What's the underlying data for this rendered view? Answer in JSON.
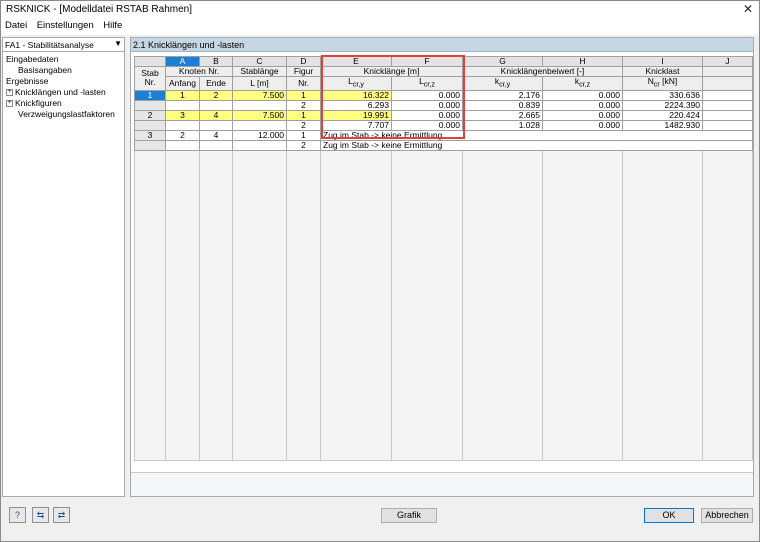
{
  "window": {
    "title": "RSKNICK - [Modelldatei RSTAB Rahmen]",
    "close": "✕"
  },
  "menu": [
    "Datei",
    "Einstellungen",
    "Hilfe"
  ],
  "left": {
    "combo": "FA1 - Stabilitätsanalyse",
    "tree": {
      "input_group": "Eingabedaten",
      "base": "Basisangaben",
      "results_group": "Ergebnisse",
      "item1": "Knicklängen und -lasten",
      "item2": "Knickfiguren",
      "item3": "Verzweigungslastfaktoren"
    }
  },
  "section_title": "2.1 Knicklängen und -lasten",
  "columns": [
    "A",
    "B",
    "C",
    "D",
    "E",
    "F",
    "G",
    "H",
    "I",
    "J"
  ],
  "headers": {
    "stab": "Stab",
    "nr": "Nr.",
    "knoten": "Knoten Nr.",
    "anfang": "Anfang",
    "ende": "Ende",
    "stablaenge": "Stablänge",
    "l_m": "L [m]",
    "figur": "Figur",
    "figur_nr": "Nr.",
    "knicklaenge": "Knicklänge [m]",
    "lcry": "L",
    "lcry_sub": "cr,y",
    "lcrz": "L",
    "lcrz_sub": "cr,z",
    "beiwert": "Knicklängenbeiwert [-]",
    "kcry": "k",
    "kcry_sub": "cr,y",
    "kcrz": "k",
    "kcrz_sub": "cr,z",
    "knicklast": "Knicklast",
    "ncr": "N",
    "ncr_sub": "cr",
    "ncr_unit": "[kN]"
  },
  "rows": [
    {
      "stab": "1",
      "anfang": "1",
      "ende": "2",
      "laenge": "7.500",
      "figur": "1",
      "lcry": "16.322",
      "lcrz": "0.000",
      "kcry": "2.176",
      "kcrz": "0.000",
      "ncr": "330.636"
    },
    {
      "stab": "",
      "anfang": "",
      "ende": "",
      "laenge": "",
      "figur": "2",
      "lcry": "6.293",
      "lcrz": "0.000",
      "kcry": "0.839",
      "kcrz": "0.000",
      "ncr": "2224.390"
    },
    {
      "stab": "2",
      "anfang": "3",
      "ende": "4",
      "laenge": "7.500",
      "figur": "1",
      "lcry": "19.991",
      "lcrz": "0.000",
      "kcry": "2.665",
      "kcrz": "0.000",
      "ncr": "220.424"
    },
    {
      "stab": "",
      "anfang": "",
      "ende": "",
      "laenge": "",
      "figur": "2",
      "lcry": "7.707",
      "lcrz": "0.000",
      "kcry": "1.028",
      "kcrz": "0.000",
      "ncr": "1482.930"
    },
    {
      "stab": "3",
      "anfang": "2",
      "ende": "4",
      "laenge": "12.000",
      "figur": "1",
      "note": "Zug im Stab -> keine Ermittlung"
    },
    {
      "stab": "",
      "anfang": "",
      "ende": "",
      "laenge": "",
      "figur": "2",
      "note": "Zug im Stab -> keine Ermittlung"
    }
  ],
  "buttons": {
    "grafik": "Grafik",
    "ok": "OK",
    "cancel": "Abbrechen"
  },
  "colors": {
    "selection": "#1b7fd6",
    "highlight_cells": "#ffff80",
    "annotation_box": "#e0413a",
    "section_header": "#c6d6e3"
  }
}
